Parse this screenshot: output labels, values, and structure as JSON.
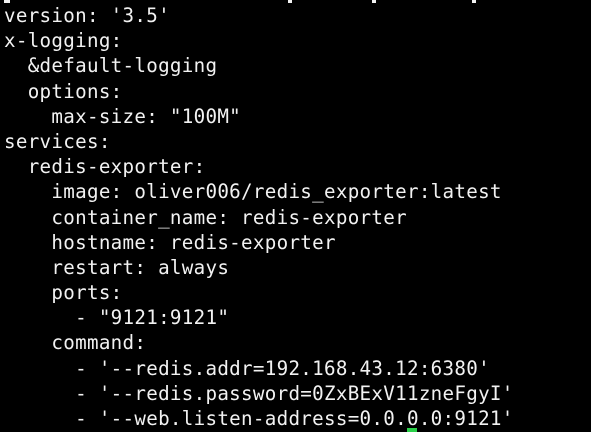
{
  "terminal": {
    "lines": [
      "version: '3.5'",
      "x-logging:",
      "  &default-logging",
      "  options:",
      "    max-size: \"100M\"",
      "services:",
      "  redis-exporter:",
      "    image: oliver006/redis_exporter:latest",
      "    container_name: redis-exporter",
      "    hostname: redis-exporter",
      "    restart: always",
      "    ports:",
      "      - \"9121:9121\"",
      "    command:",
      "      - '--redis.addr=192.168.43.12:6380'",
      "      - '--redis.password=0ZxBExV11zneFgyI'",
      "      - '--web.listen-address=0.0.0.0:9121'"
    ],
    "text_color": "#f2f2f2",
    "background_color": "#000000",
    "cursor_color": "#2bd14a"
  }
}
